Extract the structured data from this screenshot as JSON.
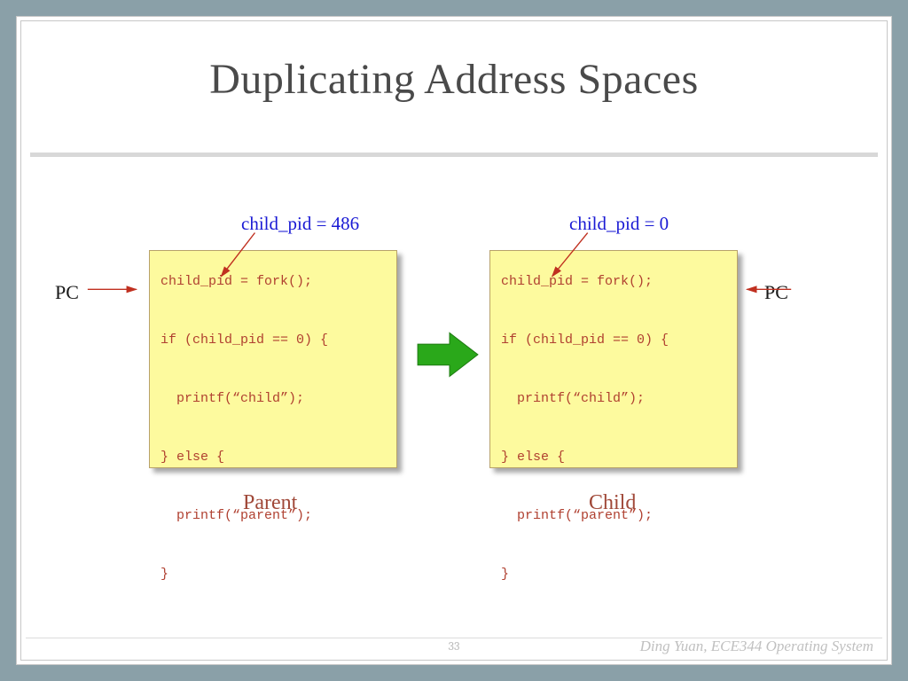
{
  "title": "Duplicating Address Spaces",
  "top_labels": {
    "parent": "child_pid = 486",
    "child": "child_pid = 0"
  },
  "pc_label_left": "PC",
  "pc_label_right": "PC",
  "code": {
    "parent": "child_pid = fork();\n\nif (child_pid == 0) {\n\n  printf(“child”);\n\n} else {\n\n  printf(“parent”);\n\n}",
    "child": "child_pid = fork();\n\nif (child_pid == 0) {\n\n  printf(“child”);\n\n} else {\n\n  printf(“parent”);\n\n}"
  },
  "captions": {
    "parent": "Parent",
    "child": "Child"
  },
  "footer": {
    "page": "33",
    "credit": "Ding Yuan, ECE344 Operating System"
  }
}
